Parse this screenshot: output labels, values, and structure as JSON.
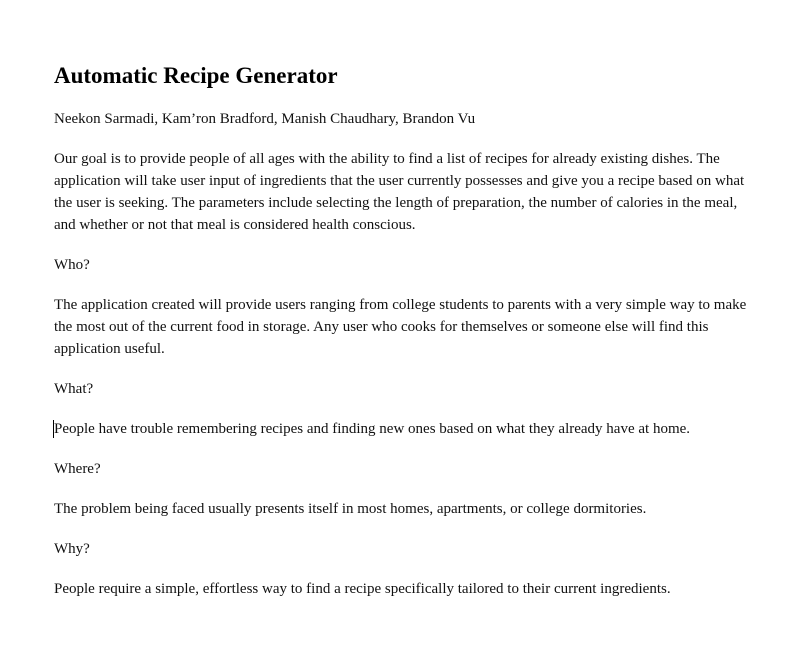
{
  "document": {
    "title": "Automatic Recipe Generator",
    "authors": "Neekon Sarmadi, Kam’ron Bradford, Manish Chaudhary, Brandon Vu",
    "intro": "Our goal is to provide people of all ages with the ability to find a list of recipes for already existing dishes. The application will take user input of ingredients that the user currently possesses and give you a recipe based on what the user is seeking. The parameters include selecting the length of preparation, the number of calories in the meal, and whether or not that meal is considered health conscious.",
    "sections": [
      {
        "heading": "Who?",
        "body": "The application created will provide users ranging from college students to parents with a very simple way to make the most out of the current food in storage. Any user who cooks for themselves or someone else will find this application useful."
      },
      {
        "heading": "What?",
        "body": "People have trouble remembering recipes and finding new ones based on what they already have at home."
      },
      {
        "heading": "Where?",
        "body": "The problem being faced usually presents itself in most homes, apartments, or college dormitories."
      },
      {
        "heading": "Why?",
        "body": "People require a simple, effortless way to find a recipe specifically tailored to their current ingredients."
      }
    ]
  }
}
